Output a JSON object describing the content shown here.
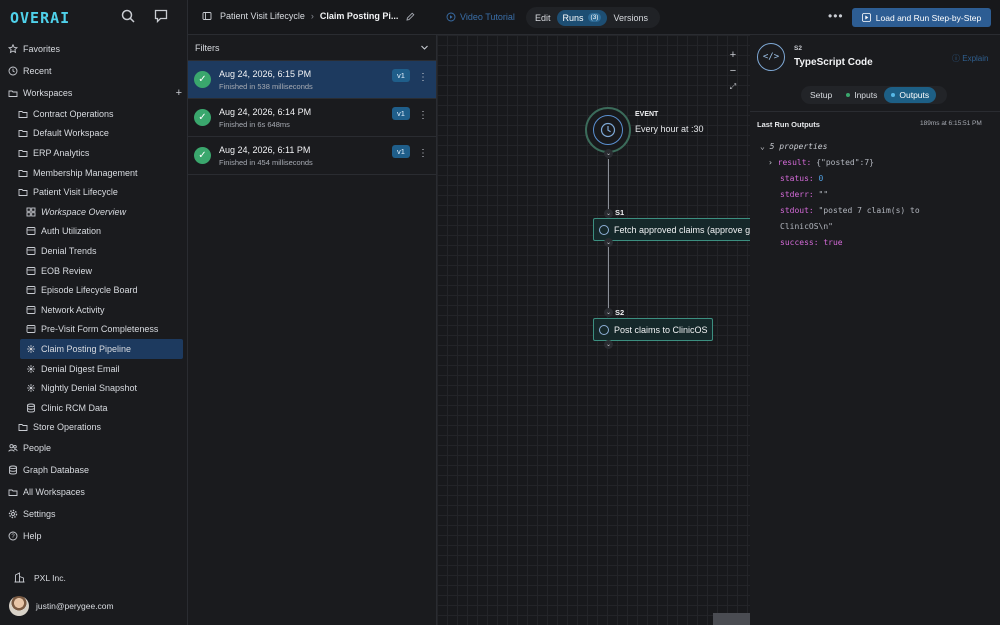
{
  "app": {
    "logo": "OVERAI"
  },
  "sidebar": {
    "favorites": "Favorites",
    "recent": "Recent",
    "workspaces": "Workspaces",
    "workspace_items": [
      "Contract Operations",
      "Default Workspace",
      "ERP Analytics",
      "Membership Management",
      "Patient Visit Lifecycle"
    ],
    "patient_children": [
      {
        "label": "Workspace Overview",
        "icon": "overview-icon"
      },
      {
        "label": "Auth Utilization",
        "icon": "board-icon"
      },
      {
        "label": "Denial Trends",
        "icon": "board-icon"
      },
      {
        "label": "EOB Review",
        "icon": "board-icon"
      },
      {
        "label": "Episode Lifecycle Board",
        "icon": "board-icon"
      },
      {
        "label": "Network Activity",
        "icon": "board-icon"
      },
      {
        "label": "Pre-Visit Form Completeness",
        "icon": "board-icon"
      },
      {
        "label": "Claim Posting Pipeline",
        "icon": "pipeline-icon"
      },
      {
        "label": "Denial Digest Email",
        "icon": "pipeline-icon"
      },
      {
        "label": "Nightly Denial Snapshot",
        "icon": "pipeline-icon"
      },
      {
        "label": "Clinic RCM Data",
        "icon": "database-icon"
      }
    ],
    "store_operations": "Store Operations",
    "people": "People",
    "graph_database": "Graph Database",
    "all_workspaces": "All Workspaces",
    "settings": "Settings",
    "help": "Help",
    "org": "PXL Inc.",
    "user_email": "justin@perygee.com"
  },
  "topbar": {
    "breadcrumb_1": "Patient Visit Lifecycle",
    "breadcrumb_2": "Claim Posting Pi...",
    "video_tutorial": "Video Tutorial",
    "tab_edit": "Edit",
    "tab_runs": "Runs",
    "runs_count": "(3)",
    "tab_versions": "Versions",
    "run_button": "Load and Run Step-by-Step"
  },
  "runs": {
    "filters_label": "Filters",
    "items": [
      {
        "date": "Aug 24, 2026, 6:15 PM",
        "sub": "Finished in 538 milliseconds",
        "version": "v1"
      },
      {
        "date": "Aug 24, 2026, 6:14 PM",
        "sub": "Finished in 6s 648ms",
        "version": "v1"
      },
      {
        "date": "Aug 24, 2026, 6:11 PM",
        "sub": "Finished in 454 milliseconds",
        "version": "v1"
      }
    ]
  },
  "canvas": {
    "event_label": "EVENT",
    "event_sub": "Every hour at :30",
    "s1_id": "S1",
    "s1_label": "Fetch approved claims (approve g",
    "s2_id": "S2",
    "s2_label": "Post claims to ClinicOS"
  },
  "panel": {
    "step": "S2",
    "title": "TypeScript Code",
    "explain": "Explain",
    "tab_setup": "Setup",
    "tab_inputs": "Inputs",
    "tab_outputs": "Outputs",
    "last_run_label": "Last Run Outputs",
    "last_run_time": "189ms at 6:15:51 PM",
    "props_count": "5 properties",
    "result_key": "result:",
    "result_val": "{\"posted\":7}",
    "status_key": "status:",
    "status_val": "0",
    "stderr_key": "stderr:",
    "stderr_val": "\"\"",
    "stdout_key": "stdout:",
    "stdout_val_1": "\"posted 7 claim(s) to",
    "stdout_val_2": "ClinicOS\\n\"",
    "success_key": "success:",
    "success_val": "true"
  }
}
